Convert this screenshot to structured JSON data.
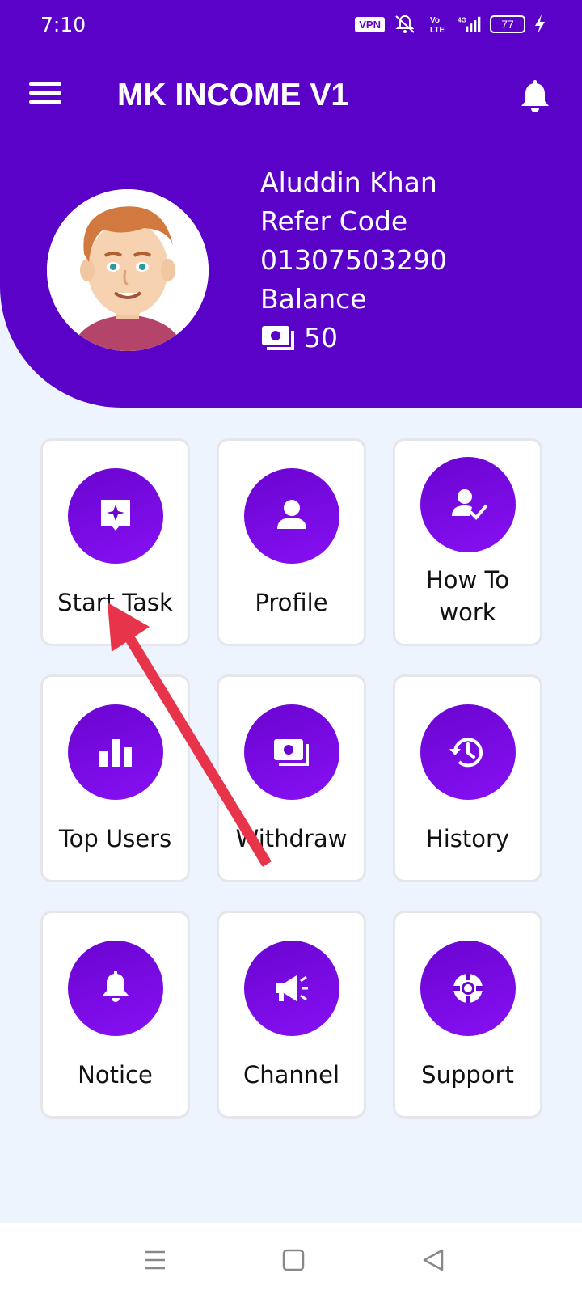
{
  "status_bar": {
    "time": "7:10",
    "vpn": "VPN",
    "battery": "77",
    "icons": [
      "vpn-icon",
      "mute-icon",
      "volte-icon",
      "signal-4g-icon",
      "battery-icon",
      "charging-icon"
    ]
  },
  "header": {
    "title": "MK INCOME V1",
    "menu_icon": "hamburger-menu-icon",
    "bell_icon": "bell-icon"
  },
  "user": {
    "name": "Aluddin Khan",
    "refer_label": "Refer Code",
    "refer_code": "01307503290",
    "balance_label": "Balance",
    "balance": "50"
  },
  "menu": {
    "items": [
      {
        "label": "Start Task",
        "icon": "task-icon"
      },
      {
        "label": "Profile",
        "icon": "user-icon"
      },
      {
        "label": "How To work",
        "icon": "user-check-icon"
      },
      {
        "label": "Top Users",
        "icon": "bar-chart-icon"
      },
      {
        "label": "Withdraw",
        "icon": "money-icon"
      },
      {
        "label": "History",
        "icon": "history-icon"
      },
      {
        "label": "Notice",
        "icon": "bell-icon"
      },
      {
        "label": "Channel",
        "icon": "megaphone-icon"
      },
      {
        "label": "Support",
        "icon": "lifebuoy-icon"
      }
    ]
  },
  "colors": {
    "primary": "#5a02c7",
    "accent": "#8710f4",
    "background": "#eef4fd",
    "annotation_arrow": "#e8344a"
  },
  "nav_bar": {
    "icons": [
      "recent-apps-icon",
      "home-icon",
      "back-icon"
    ]
  }
}
